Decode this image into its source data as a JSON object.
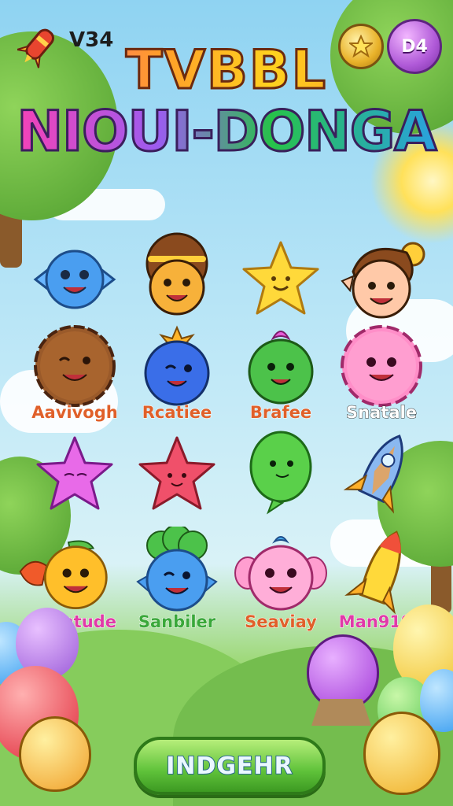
{
  "hud": {
    "version_text": "V34",
    "level_badge": "D4",
    "icons": [
      "rocket-icon",
      "star-coin-icon",
      "balloon-level-icon"
    ]
  },
  "title": {
    "line1": "TVBBL",
    "line2": "NIOUI-DONGA"
  },
  "characters": [
    {
      "row": 0,
      "col": 0,
      "icon": "blue-candy-face-icon",
      "label": ""
    },
    {
      "row": 0,
      "col": 1,
      "icon": "girl-face-icon",
      "label": ""
    },
    {
      "row": 0,
      "col": 2,
      "icon": "yellow-star-icon",
      "label": ""
    },
    {
      "row": 0,
      "col": 3,
      "icon": "boy-face-icon",
      "label": ""
    },
    {
      "row": 1,
      "col": 0,
      "icon": "brown-cookie-face-icon",
      "label": "Aavivogh"
    },
    {
      "row": 1,
      "col": 1,
      "icon": "blue-berry-face-icon",
      "label": "Rcatiee"
    },
    {
      "row": 1,
      "col": 2,
      "icon": "green-sprout-face-icon",
      "label": "Brafee"
    },
    {
      "row": 1,
      "col": 3,
      "icon": "pink-flower-face-icon",
      "label": "Snatale"
    },
    {
      "row": 2,
      "col": 0,
      "icon": "purple-star-icon",
      "label": ""
    },
    {
      "row": 2,
      "col": 1,
      "icon": "red-star-icon",
      "label": ""
    },
    {
      "row": 2,
      "col": 2,
      "icon": "green-balloon-face-icon",
      "label": ""
    },
    {
      "row": 2,
      "col": 3,
      "icon": "crystal-rocket-icon",
      "label": ""
    },
    {
      "row": 3,
      "col": 0,
      "icon": "orange-fruit-face-icon",
      "label": "Wentude"
    },
    {
      "row": 3,
      "col": 1,
      "icon": "blue-broccoli-face-icon",
      "label": "Sanbiler"
    },
    {
      "row": 3,
      "col": 2,
      "icon": "pink-axolotl-face-icon",
      "label": "Seaviay"
    },
    {
      "row": 3,
      "col": 3,
      "icon": "yellow-rocket-icon",
      "label": "Man9190"
    }
  ],
  "label_colors": [
    "#e03aa8",
    "#3aa83a",
    "#e0602a",
    "#e03aa8"
  ],
  "label_colors_row1": [
    "#e0602a",
    "#e0602a",
    "#e0602a",
    "#ffffff"
  ],
  "play_button": {
    "label": "INDGEHR"
  },
  "colors": {
    "title_outline": "#6b2a10",
    "button_green": "#5fc23a",
    "sky": "#8fd3f2",
    "grass": "#7cc25a"
  }
}
